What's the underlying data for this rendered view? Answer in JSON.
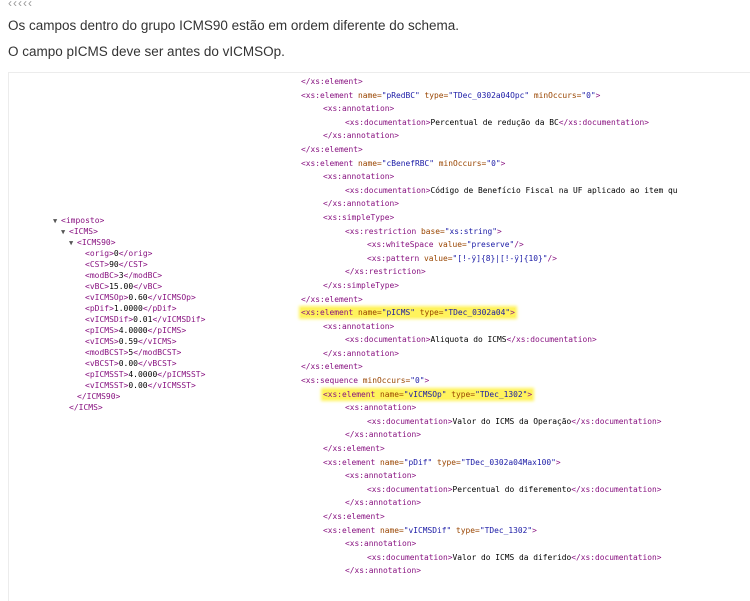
{
  "top_marks": "‹‹‹‹‹",
  "paragraphs": [
    "Os campos dentro do grupo ICMS90 estão em ordem diferente do schema.",
    "O campo pICMS deve ser antes do vICMSOp."
  ],
  "highlight_color": "#fff35c",
  "xml_tree": [
    {
      "indent": 0,
      "toggle": "▼",
      "tag": "<imposto>",
      "value": "",
      "close": ""
    },
    {
      "indent": 1,
      "toggle": "▼",
      "tag": "<ICMS>",
      "value": "",
      "close": ""
    },
    {
      "indent": 2,
      "toggle": "▼",
      "tag": "<ICMS90>",
      "value": "",
      "close": ""
    },
    {
      "indent": 3,
      "toggle": "",
      "tag": "<orig>",
      "value": "0",
      "close": "</orig>"
    },
    {
      "indent": 3,
      "toggle": "",
      "tag": "<CST>",
      "value": "90",
      "close": "</CST>"
    },
    {
      "indent": 3,
      "toggle": "",
      "tag": "<modBC>",
      "value": "3",
      "close": "</modBC>"
    },
    {
      "indent": 3,
      "toggle": "",
      "tag": "<vBC>",
      "value": "15.00",
      "close": "</vBC>"
    },
    {
      "indent": 3,
      "toggle": "",
      "tag": "<vICMSOp>",
      "value": "0.60",
      "close": "</vICMSOp>"
    },
    {
      "indent": 3,
      "toggle": "",
      "tag": "<pDif>",
      "value": "1.0000",
      "close": "</pDif>"
    },
    {
      "indent": 3,
      "toggle": "",
      "tag": "<vICMSDif>",
      "value": "0.01",
      "close": "</vICMSDif>"
    },
    {
      "indent": 3,
      "toggle": "",
      "tag": "<pICMS>",
      "value": "4.0000",
      "close": "</pICMS>"
    },
    {
      "indent": 3,
      "toggle": "",
      "tag": "<vICMS>",
      "value": "0.59",
      "close": "</vICMS>"
    },
    {
      "indent": 3,
      "toggle": "",
      "tag": "<modBCST>",
      "value": "5",
      "close": "</modBCST>"
    },
    {
      "indent": 3,
      "toggle": "",
      "tag": "<vBCST>",
      "value": "0.00",
      "close": "</vBCST>"
    },
    {
      "indent": 3,
      "toggle": "",
      "tag": "<pICMSST>",
      "value": "4.0000",
      "close": "</pICMSST>"
    },
    {
      "indent": 3,
      "toggle": "",
      "tag": "<vICMSST>",
      "value": "0.00",
      "close": "</vICMSST>"
    },
    {
      "indent": 2,
      "toggle": "",
      "tag": "</ICMS90>",
      "value": "",
      "close": ""
    },
    {
      "indent": 1,
      "toggle": "",
      "tag": "</ICMS>",
      "value": "",
      "close": ""
    }
  ],
  "schema_lines": [
    {
      "indent": 1,
      "parts": [
        [
          "t",
          "</xs:element>"
        ]
      ]
    },
    {
      "indent": 1,
      "parts": [
        [
          "t",
          "<xs:element "
        ],
        [
          "a",
          "name="
        ],
        [
          "v",
          "\"pRedBC\" "
        ],
        [
          "a",
          "type="
        ],
        [
          "v",
          "\"TDec_0302a04Opc\" "
        ],
        [
          "a",
          "minOccurs="
        ],
        [
          "v",
          "\"0\""
        ],
        [
          "t",
          ">"
        ]
      ]
    },
    {
      "indent": 2,
      "parts": [
        [
          "t",
          "<xs:annotation>"
        ]
      ]
    },
    {
      "indent": 3,
      "parts": [
        [
          "t",
          "<xs:documentation>"
        ],
        [
          "x",
          "Percentual de redução da BC"
        ],
        [
          "t",
          "</xs:documentation>"
        ]
      ]
    },
    {
      "indent": 2,
      "parts": [
        [
          "t",
          "</xs:annotation>"
        ]
      ]
    },
    {
      "indent": 1,
      "parts": [
        [
          "t",
          "</xs:element>"
        ]
      ]
    },
    {
      "indent": 1,
      "parts": [
        [
          "t",
          "<xs:element "
        ],
        [
          "a",
          "name="
        ],
        [
          "v",
          "\"cBenefRBC\" "
        ],
        [
          "a",
          "minOccurs="
        ],
        [
          "v",
          "\"0\""
        ],
        [
          "t",
          ">"
        ]
      ]
    },
    {
      "indent": 2,
      "parts": [
        [
          "t",
          "<xs:annotation>"
        ]
      ]
    },
    {
      "indent": 3,
      "parts": [
        [
          "t",
          "<xs:documentation>"
        ],
        [
          "x",
          "Código de Benefício Fiscal na UF aplicado ao item qu"
        ]
      ]
    },
    {
      "indent": 2,
      "parts": [
        [
          "t",
          "</xs:annotation>"
        ]
      ]
    },
    {
      "indent": 2,
      "parts": [
        [
          "t",
          "<xs:simpleType>"
        ]
      ]
    },
    {
      "indent": 3,
      "parts": [
        [
          "t",
          "<xs:restriction "
        ],
        [
          "a",
          "base="
        ],
        [
          "v",
          "\"xs:string\""
        ],
        [
          "t",
          ">"
        ]
      ]
    },
    {
      "indent": 4,
      "parts": [
        [
          "t",
          "<xs:whiteSpace "
        ],
        [
          "a",
          "value="
        ],
        [
          "v",
          "\"preserve\""
        ],
        [
          "t",
          "/>"
        ]
      ]
    },
    {
      "indent": 4,
      "parts": [
        [
          "t",
          "<xs:pattern "
        ],
        [
          "a",
          "value="
        ],
        [
          "v",
          "\"[!-ÿ]{8}|[!-ÿ]{10}\""
        ],
        [
          "t",
          "/>"
        ]
      ]
    },
    {
      "indent": 3,
      "parts": [
        [
          "t",
          "</xs:restriction>"
        ]
      ]
    },
    {
      "indent": 2,
      "parts": [
        [
          "t",
          "</xs:simpleType>"
        ]
      ]
    },
    {
      "indent": 1,
      "parts": [
        [
          "t",
          "</xs:element>"
        ]
      ]
    },
    {
      "indent": 1,
      "highlight": true,
      "parts": [
        [
          "t",
          "<xs:element "
        ],
        [
          "a",
          "name="
        ],
        [
          "v",
          "\"pICMS\" "
        ],
        [
          "a",
          "type="
        ],
        [
          "v",
          "\"TDec_0302a04\""
        ],
        [
          "t",
          ">"
        ]
      ]
    },
    {
      "indent": 2,
      "parts": [
        [
          "t",
          "<xs:annotation>"
        ]
      ]
    },
    {
      "indent": 3,
      "parts": [
        [
          "t",
          "<xs:documentation>"
        ],
        [
          "x",
          "Aliquota do ICMS"
        ],
        [
          "t",
          "</xs:documentation>"
        ]
      ]
    },
    {
      "indent": 2,
      "parts": [
        [
          "t",
          "</xs:annotation>"
        ]
      ]
    },
    {
      "indent": 1,
      "parts": [
        [
          "t",
          "</xs:element>"
        ]
      ]
    },
    {
      "indent": 1,
      "parts": [
        [
          "t",
          "<xs:sequence "
        ],
        [
          "a",
          "minOccurs="
        ],
        [
          "v",
          "\"0\""
        ],
        [
          "t",
          ">"
        ]
      ]
    },
    {
      "indent": 2,
      "highlight": true,
      "parts": [
        [
          "t",
          "<xs:element "
        ],
        [
          "a",
          "name="
        ],
        [
          "v",
          "\"vICMSOp\" "
        ],
        [
          "a",
          "type="
        ],
        [
          "v",
          "\"TDec_1302\""
        ],
        [
          "t",
          ">"
        ]
      ]
    },
    {
      "indent": 3,
      "parts": [
        [
          "t",
          "<xs:annotation>"
        ]
      ]
    },
    {
      "indent": 4,
      "parts": [
        [
          "t",
          "<xs:documentation>"
        ],
        [
          "x",
          "Valor do ICMS da Operação"
        ],
        [
          "t",
          "</xs:documentation>"
        ]
      ]
    },
    {
      "indent": 3,
      "parts": [
        [
          "t",
          "</xs:annotation>"
        ]
      ]
    },
    {
      "indent": 2,
      "parts": [
        [
          "t",
          "</xs:element>"
        ]
      ]
    },
    {
      "indent": 2,
      "parts": [
        [
          "t",
          "<xs:element "
        ],
        [
          "a",
          "name="
        ],
        [
          "v",
          "\"pDif\" "
        ],
        [
          "a",
          "type="
        ],
        [
          "v",
          "\"TDec_0302a04Max100\""
        ],
        [
          "t",
          ">"
        ]
      ]
    },
    {
      "indent": 3,
      "parts": [
        [
          "t",
          "<xs:annotation>"
        ]
      ]
    },
    {
      "indent": 4,
      "parts": [
        [
          "t",
          "<xs:documentation>"
        ],
        [
          "x",
          "Percentual do diferemento"
        ],
        [
          "t",
          "</xs:documentation>"
        ]
      ]
    },
    {
      "indent": 3,
      "parts": [
        [
          "t",
          "</xs:annotation>"
        ]
      ]
    },
    {
      "indent": 2,
      "parts": [
        [
          "t",
          "</xs:element>"
        ]
      ]
    },
    {
      "indent": 2,
      "parts": [
        [
          "t",
          "<xs:element "
        ],
        [
          "a",
          "name="
        ],
        [
          "v",
          "\"vICMSDif\" "
        ],
        [
          "a",
          "type="
        ],
        [
          "v",
          "\"TDec_1302\""
        ],
        [
          "t",
          ">"
        ]
      ]
    },
    {
      "indent": 3,
      "parts": [
        [
          "t",
          "<xs:annotation>"
        ]
      ]
    },
    {
      "indent": 4,
      "parts": [
        [
          "t",
          "<xs:documentation>"
        ],
        [
          "x",
          "Valor do ICMS da diferido"
        ],
        [
          "t",
          "</xs:documentation>"
        ]
      ]
    },
    {
      "indent": 3,
      "parts": [
        [
          "t",
          "</xs:annotation>"
        ]
      ]
    }
  ]
}
